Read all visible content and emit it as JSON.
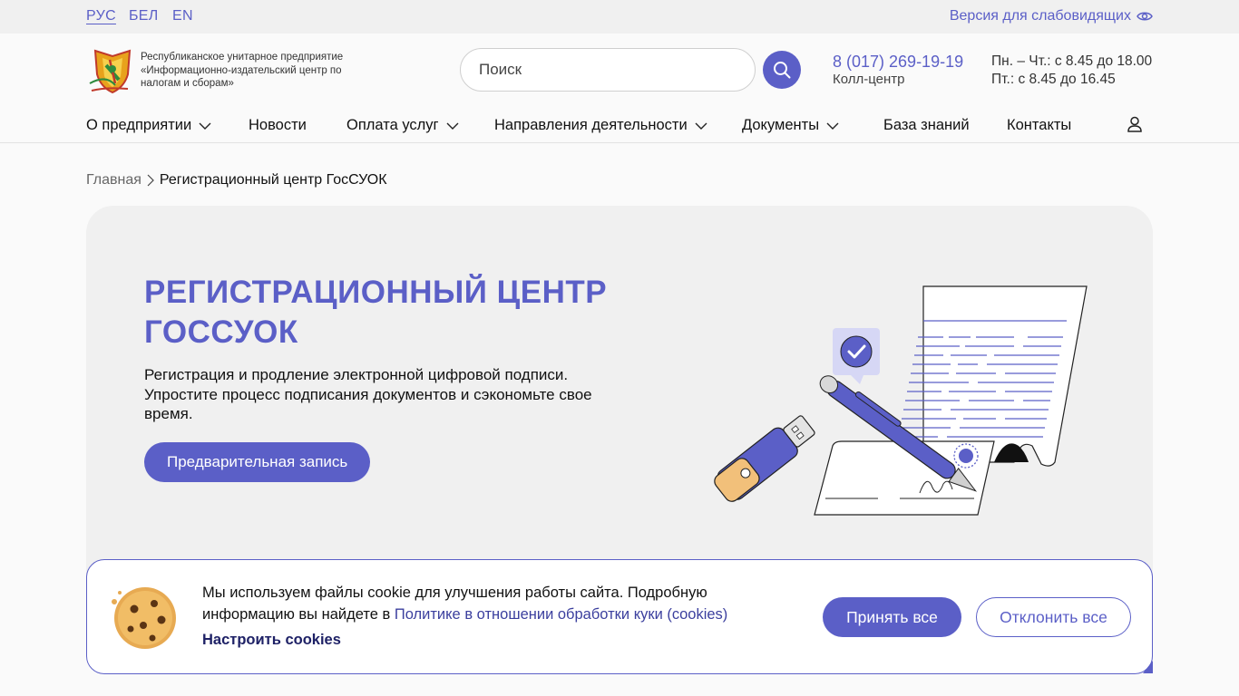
{
  "topbar": {
    "languages": [
      "РУС",
      "БЕЛ",
      "EN"
    ],
    "active_language": "РУС",
    "vision_label": "Версия для слабовидящих"
  },
  "header": {
    "org_name": "Республиканское унитарное предприятие «Информационно-издательский центр по налогам и сборам»",
    "search_placeholder": "Поиск",
    "phone": "8 (017) 269-19-19",
    "phone_label": "Колл-центр",
    "hours_line1": "Пн. – Чт.: с 8.45 до 18.00",
    "hours_line2": "Пт.: с 8.45 до 16.45"
  },
  "nav": {
    "items": [
      {
        "label": "О предприятии",
        "dropdown": true
      },
      {
        "label": "Новости",
        "dropdown": false
      },
      {
        "label": "Оплата услуг",
        "dropdown": true
      },
      {
        "label": "Направления деятельности",
        "dropdown": true
      },
      {
        "label": "Документы",
        "dropdown": true
      },
      {
        "label": "База знаний",
        "dropdown": false
      },
      {
        "label": "Контакты",
        "dropdown": false
      }
    ]
  },
  "breadcrumb": {
    "home": "Главная",
    "current": "Регистрационный центр ГосСУОК"
  },
  "hero": {
    "title": "Регистрационный центр ГосСУОК",
    "text": "Регистрация и продление электронной цифровой подписи. Упростите процесс подписания документов и сэкономьте свое время.",
    "button": "Предварительная запись"
  },
  "cookie": {
    "text": "Мы используем файлы cookie для улучшения работы сайта. Подробную информацию вы найдете в ",
    "link": "Политике в отношении обработки куки (cookies)",
    "settings": "Настроить cookies",
    "accept": "Принять все",
    "reject": "Отклонить все"
  },
  "colors": {
    "accent": "#5b5fc7",
    "hero_bg": "#f0f0f0",
    "topbar_bg": "#f0f0f0"
  }
}
